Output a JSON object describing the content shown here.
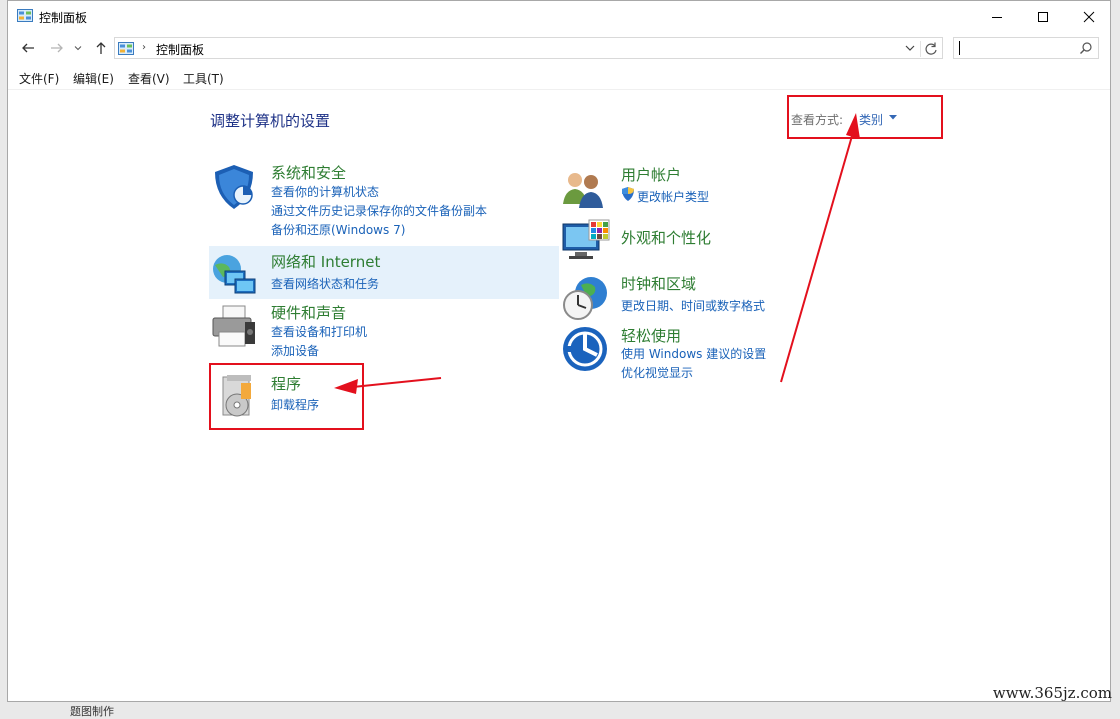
{
  "window": {
    "title": "控制面板",
    "controls": {
      "minimize": "minimize",
      "maximize": "maximize",
      "close": "close"
    }
  },
  "address": {
    "path": "控制面板",
    "search_placeholder": ""
  },
  "menu": [
    {
      "label": "文件(F)"
    },
    {
      "label": "编辑(E)"
    },
    {
      "label": "查看(V)"
    },
    {
      "label": "工具(T)"
    }
  ],
  "content": {
    "heading": "调整计算机的设置",
    "view_by_label": "查看方式:",
    "view_by_value": "类别"
  },
  "categories": {
    "system": {
      "title": "系统和安全",
      "links": [
        "查看你的计算机状态",
        "通过文件历史记录保存你的文件备份副本",
        "备份和还原(Windows 7)"
      ],
      "icon": "shield-icon"
    },
    "network": {
      "title": "网络和 Internet",
      "links": [
        "查看网络状态和任务"
      ],
      "icon": "network-globe-icon"
    },
    "hardware": {
      "title": "硬件和声音",
      "links": [
        "查看设备和打印机",
        "添加设备"
      ],
      "icon": "printer-icon"
    },
    "programs": {
      "title": "程序",
      "links": [
        "卸载程序"
      ],
      "icon": "programs-disc-icon"
    },
    "users": {
      "title": "用户帐户",
      "links": [
        "更改帐户类型"
      ],
      "icon": "users-icon"
    },
    "appearance": {
      "title": "外观和个性化",
      "links": [],
      "icon": "monitor-palette-icon"
    },
    "clock": {
      "title": "时钟和区域",
      "links": [
        "更改日期、时间或数字格式"
      ],
      "icon": "clock-globe-icon"
    },
    "ease": {
      "title": "轻松使用",
      "links": [
        "使用 Windows 建议的设置",
        "优化视觉显示"
      ],
      "icon": "ease-of-access-icon"
    }
  },
  "watermark": "www.365jz.com",
  "taskbar_hint": "题图制作"
}
